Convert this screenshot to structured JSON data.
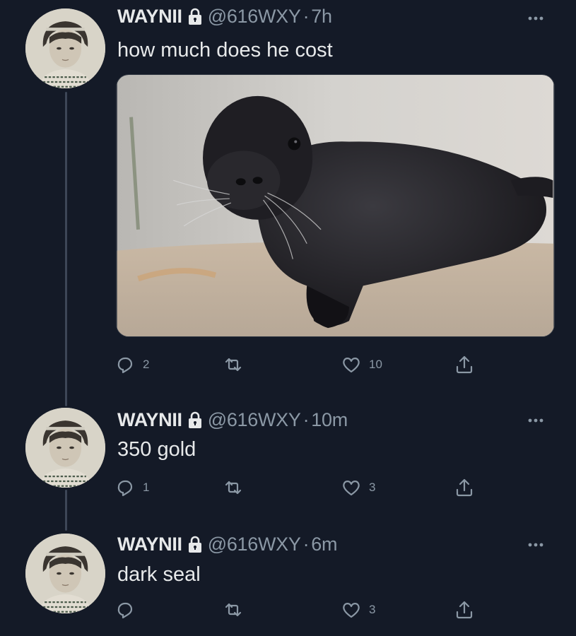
{
  "theme": {
    "background": "#141a27",
    "text": "#e7e9ea",
    "muted": "#8b98a5",
    "thread_line": "#3d4657"
  },
  "tweets": [
    {
      "name": "WAYNII",
      "handle": "@616WXY",
      "separator": "·",
      "time": "7h",
      "text": "how much does he cost",
      "has_media": true,
      "media_icon": "seal-photo",
      "reply_count": "2",
      "retweet_count": "",
      "like_count": "10"
    },
    {
      "name": "WAYNII",
      "handle": "@616WXY",
      "separator": "·",
      "time": "10m",
      "text": "350 gold",
      "has_media": false,
      "reply_count": "1",
      "retweet_count": "",
      "like_count": "3"
    },
    {
      "name": "WAYNII",
      "handle": "@616WXY",
      "separator": "·",
      "time": "6m",
      "text": "dark seal",
      "has_media": false,
      "reply_count": "",
      "retweet_count": "",
      "like_count": "3"
    }
  ],
  "icons": {
    "verified_lock": "lock-icon",
    "more": "more-options-icon",
    "reply": "reply-icon",
    "retweet": "retweet-icon",
    "like": "like-icon",
    "share": "share-icon"
  }
}
